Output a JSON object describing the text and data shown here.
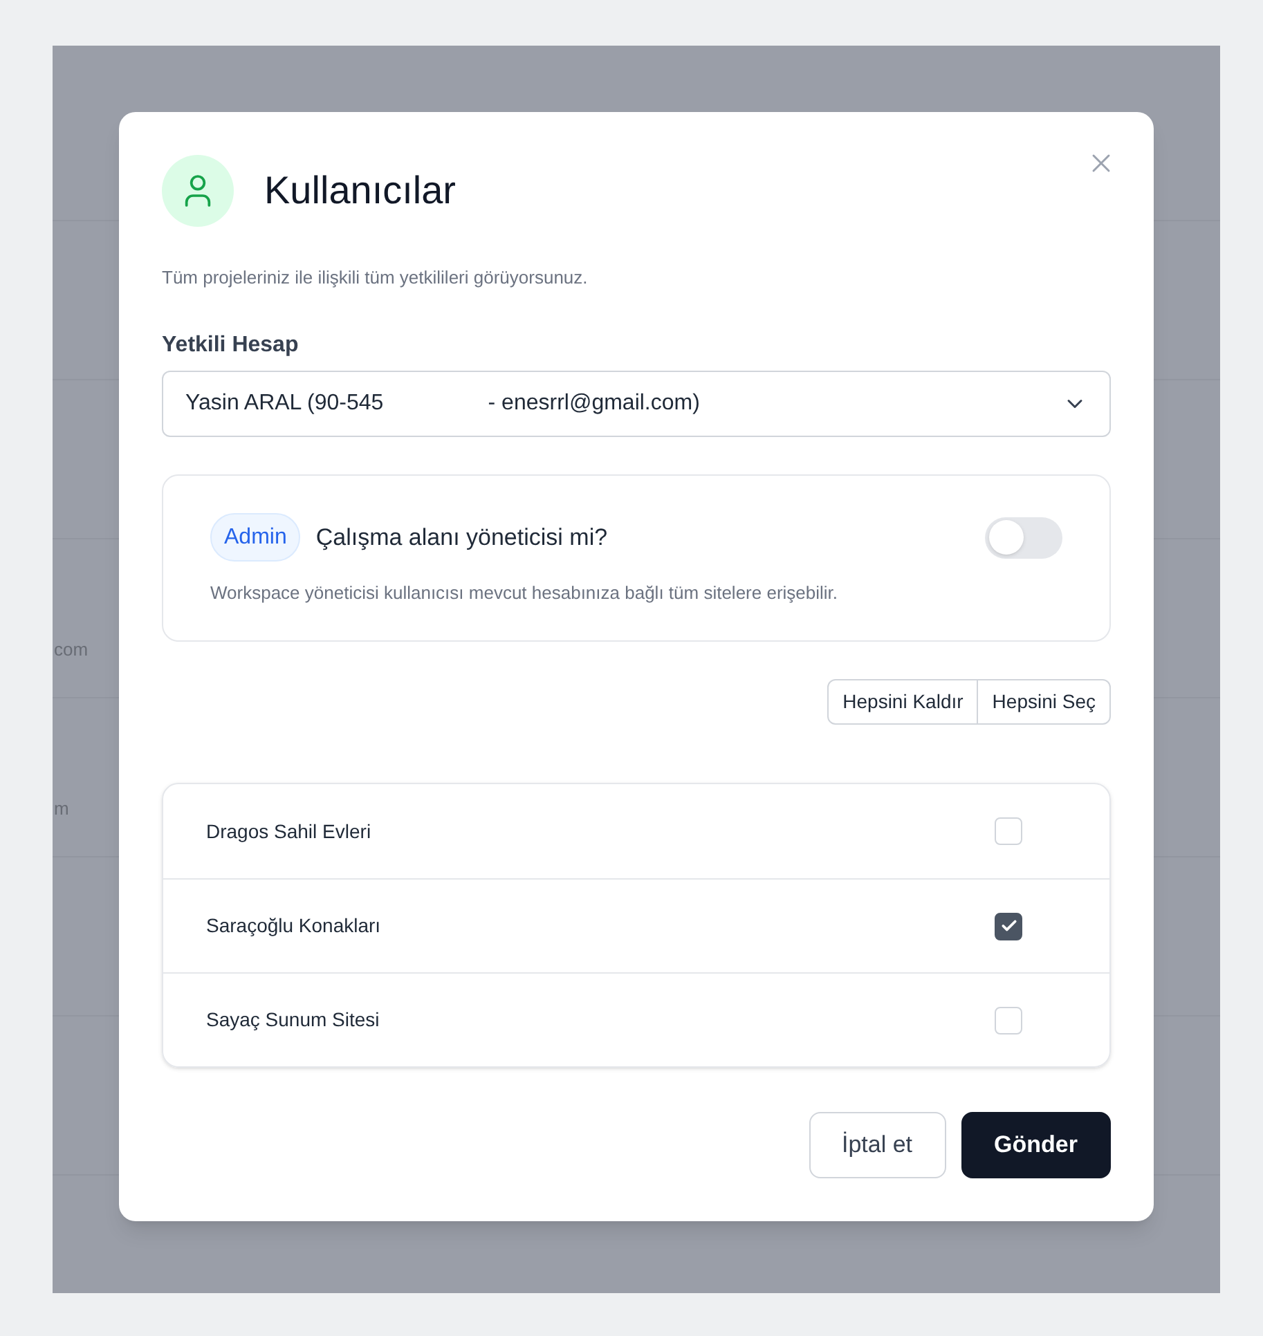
{
  "background": {
    "rows": [
      {
        "text": "com"
      },
      {
        "text": "m"
      }
    ]
  },
  "dialog": {
    "title": "Kullanıcılar",
    "description": "Tüm projeleriniz ile ilişkili tüm yetkilileri görüyorsunuz.",
    "account_field": {
      "label": "Yetkili Hesap",
      "value": "Yasin ARAL (90-545                 - enesrrl@gmail.com)"
    },
    "admin": {
      "badge": "Admin",
      "question": "Çalışma alanı yöneticisi mi?",
      "on": false,
      "note": "Workspace yöneticisi kullanıcısı mevcut hesabınıza bağlı tüm sitelere erişebilir."
    },
    "bulk_buttons": [
      "Hepsini Kaldır",
      "Hepsini Seç"
    ],
    "sites": [
      {
        "name": "Dragos Sahil Evleri",
        "checked": false
      },
      {
        "name": "Saraçoğlu Konakları",
        "checked": true
      },
      {
        "name": "Sayaç Sunum Sitesi",
        "checked": false
      }
    ],
    "footer_buttons": [
      {
        "label": "İptal et",
        "kind": "secondary"
      },
      {
        "label": "Gönder",
        "kind": "primary"
      }
    ]
  }
}
